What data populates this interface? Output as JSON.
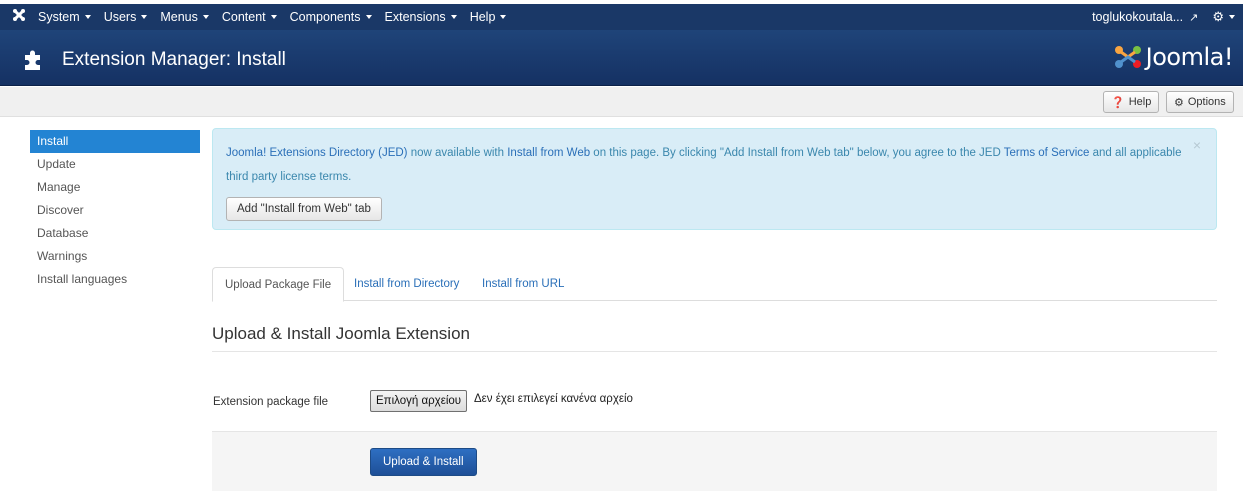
{
  "navbar": {
    "brand_icon": "joomla-icon",
    "menus": [
      "System",
      "Users",
      "Menus",
      "Content",
      "Components",
      "Extensions",
      "Help"
    ],
    "user": "toglukokoutala...",
    "external_icon": "external-link-icon",
    "settings_icon": "gear-icon"
  },
  "header": {
    "icon": "puzzle-icon",
    "title": "Extension Manager: Install",
    "logo_text": "Joomla!"
  },
  "toolbar": {
    "help_label": "Help",
    "options_label": "Options"
  },
  "sidebar": {
    "items": [
      {
        "label": "Install",
        "active": true
      },
      {
        "label": "Update",
        "active": false
      },
      {
        "label": "Manage",
        "active": false
      },
      {
        "label": "Discover",
        "active": false
      },
      {
        "label": "Database",
        "active": false
      },
      {
        "label": "Warnings",
        "active": false
      },
      {
        "label": "Install languages",
        "active": false
      }
    ]
  },
  "alert": {
    "link_jed": "Joomla! Extensions Directory (JED)",
    "text_1": " now available with ",
    "link_install_web": "Install from Web",
    "text_2": " on this page.  By clicking \"Add Install from Web tab\" below, you agree to the JED ",
    "link_tos": "Terms of Service",
    "text_3": " and all applicable third party license terms.",
    "button_label": "Add \"Install from Web\" tab",
    "close": "×"
  },
  "tabs": [
    "Upload Package File",
    "Install from Directory",
    "Install from URL"
  ],
  "form": {
    "heading": "Upload & Install Joomla Extension",
    "field_label": "Extension package file",
    "file_button": "Επιλογή αρχείου",
    "file_status": "Δεν έχει επιλεγεί κανένα αρχείο",
    "submit_label": "Upload & Install"
  },
  "colors": {
    "navbar": "#1a3867",
    "header": "#1f4479",
    "active_item": "#2384d3",
    "alert_bg": "#d9edf7",
    "link": "#2a6fb8",
    "primary": "#2e6fc2"
  }
}
